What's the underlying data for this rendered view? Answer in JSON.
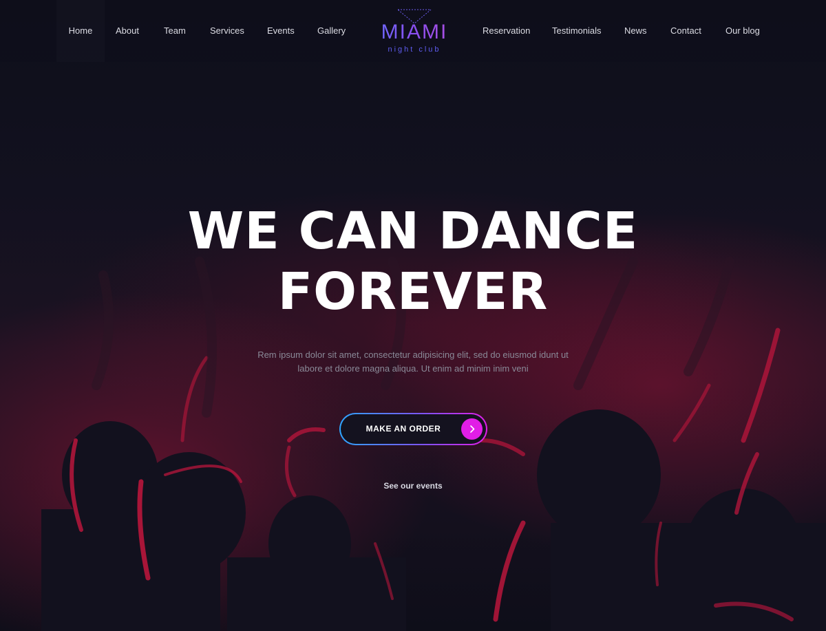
{
  "brand": {
    "title": "MIAMI",
    "subtitle": "night club",
    "accent_gradient": [
      "#6a6cff",
      "#b04fe0"
    ]
  },
  "nav": {
    "left": [
      {
        "label": "Home"
      },
      {
        "label": "About"
      },
      {
        "label": "Team"
      },
      {
        "label": "Services"
      },
      {
        "label": "Events"
      },
      {
        "label": "Gallery"
      }
    ],
    "right": [
      {
        "label": "Reservation"
      },
      {
        "label": "Testimonials"
      },
      {
        "label": "News"
      },
      {
        "label": "Contact"
      },
      {
        "label": "Our blog"
      }
    ]
  },
  "hero": {
    "title_line1": "WE CAN DANCE",
    "title_line2": "FOREVER",
    "description_line1": "Rem ipsum dolor sit amet, consectetur adipisicing elit, sed do eiusmod  idunt ut",
    "description_line2": "labore et dolore magna aliqua. Ut enim ad minim inim veni",
    "cta_label": "MAKE AN ORDER",
    "cta_icon": "chevron-right-icon",
    "secondary_link": "See our events"
  },
  "colors": {
    "background": "#0f101c",
    "crowd_highlight": "#d0183f",
    "button_border_start": "#2ea6ff",
    "button_border_end": "#e01ee8",
    "button_icon_bg": "#e11ee6"
  }
}
